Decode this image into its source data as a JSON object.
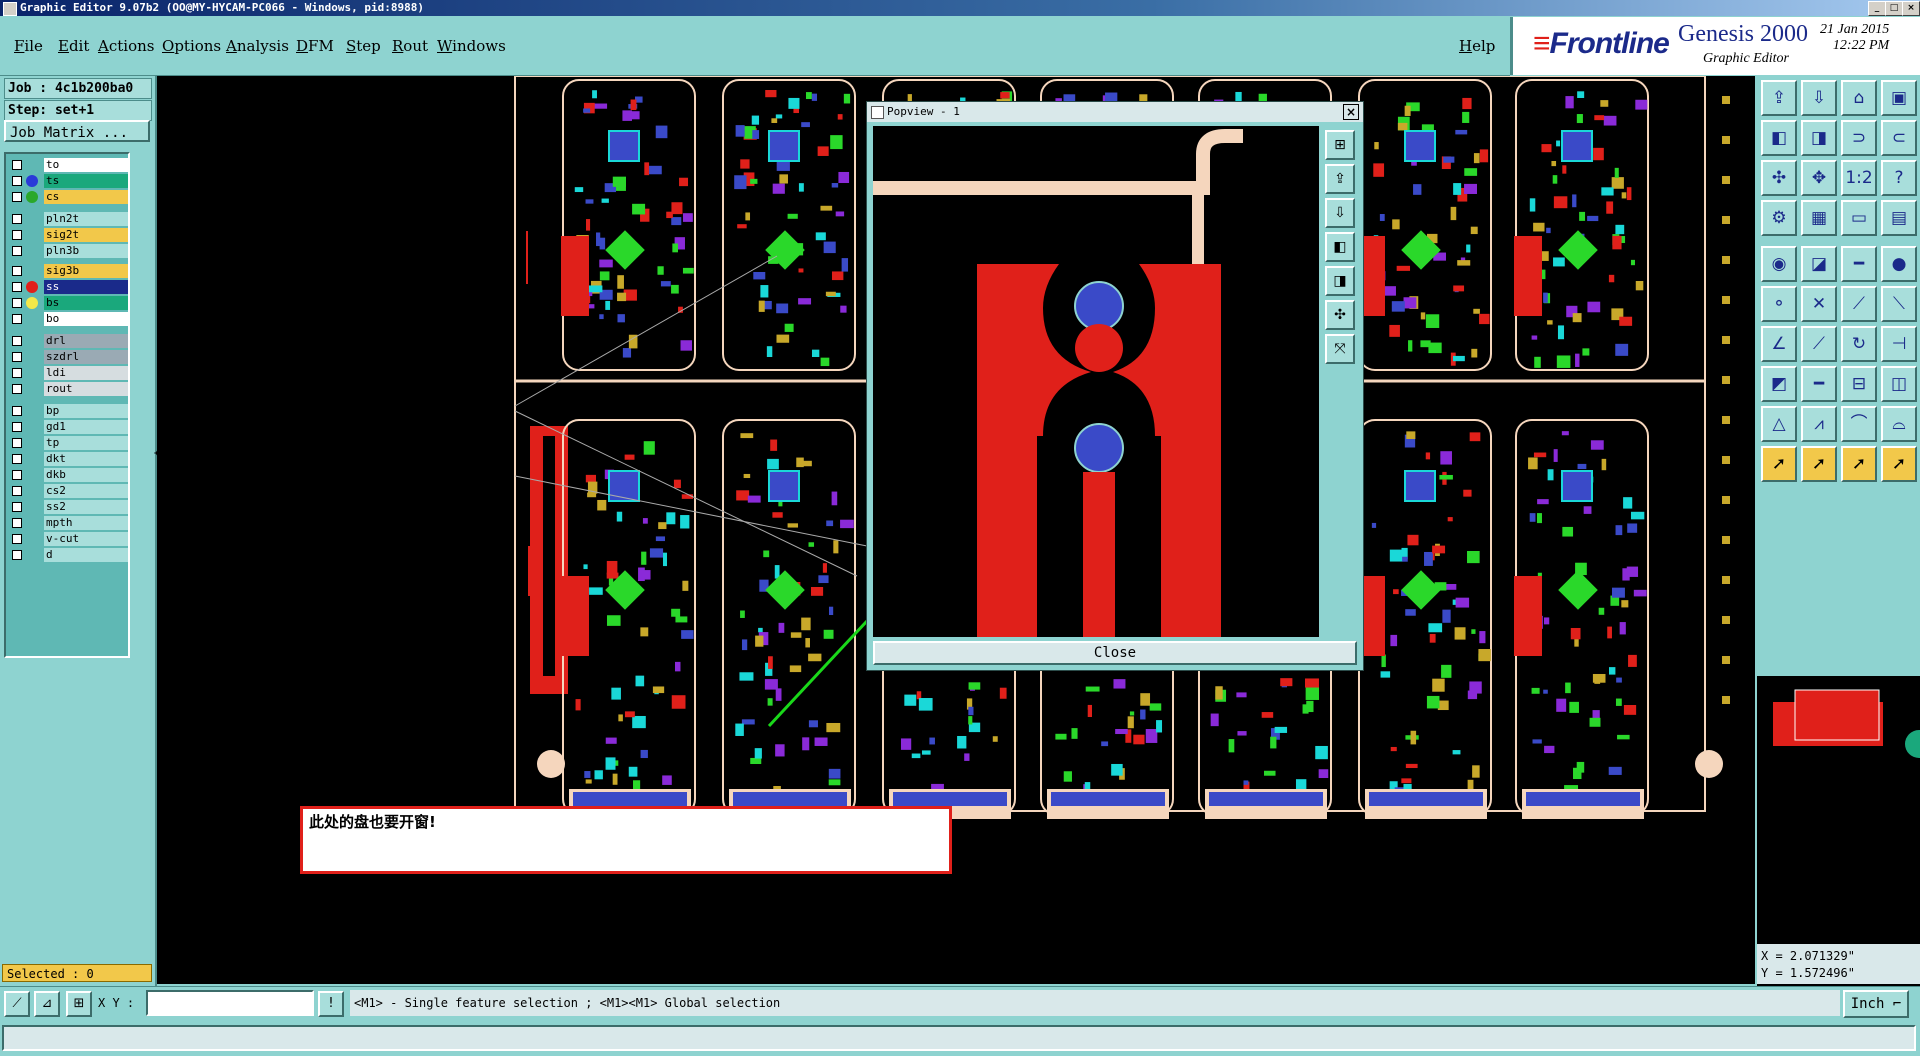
{
  "window": {
    "title": "Graphic Editor 9.07b2 (OO@MY-HYCAM-PC066 - Windows, pid:8988)",
    "controls": [
      "_",
      "□",
      "×"
    ]
  },
  "menu": [
    "File",
    "Edit",
    "Actions",
    "Options",
    "Analysis",
    "DFM",
    "Step",
    "Rout",
    "Windows"
  ],
  "help_label": "Help",
  "brand": {
    "logo": "Frontline",
    "product": "Genesis 2000",
    "subtitle": "Graphic Editor",
    "date": "21 Jan 2015",
    "time": "12:22 PM"
  },
  "job": {
    "job_line": "Job : 4c1b200ba0",
    "step_line": "Step: set+1",
    "matrix_button": "Job Matrix ..."
  },
  "layers": [
    {
      "name": "to",
      "color": "#ffffff",
      "dot": ""
    },
    {
      "name": "ts",
      "color": "#1aa87c",
      "dot": "#2a3ad8"
    },
    {
      "name": "cs",
      "color": "#f2c84a",
      "dot": "#2aa82a"
    },
    {
      "name": "pln2t",
      "color": "#a8dedb",
      "dot": ""
    },
    {
      "name": "sig2t",
      "color": "#f2c84a",
      "dot": ""
    },
    {
      "name": "pln3b",
      "color": "#a8dedb",
      "dot": ""
    },
    {
      "name": "sig3b",
      "color": "#f2c84a",
      "dot": ""
    },
    {
      "name": "ss",
      "color": "#1a2a8a",
      "dot": "#e0201a"
    },
    {
      "name": "bs",
      "color": "#1aa87c",
      "dot": "#f2e84a"
    },
    {
      "name": "bo",
      "color": "#ffffff",
      "dot": ""
    },
    {
      "name": "drl",
      "color": "#9aaab4",
      "dot": ""
    },
    {
      "name": "szdrl",
      "color": "#9aaab4",
      "dot": ""
    },
    {
      "name": "ldi",
      "color": "#d6dde0",
      "dot": ""
    },
    {
      "name": "rout",
      "color": "#d6dde0",
      "dot": ""
    },
    {
      "name": "bp",
      "color": "#a8dedb",
      "dot": ""
    },
    {
      "name": "gd1",
      "color": "#a8dedb",
      "dot": ""
    },
    {
      "name": "tp",
      "color": "#a8dedb",
      "dot": ""
    },
    {
      "name": "dkt",
      "color": "#a8dedb",
      "dot": ""
    },
    {
      "name": "dkb",
      "color": "#a8dedb",
      "dot": ""
    },
    {
      "name": "cs2",
      "color": "#a8dedb",
      "dot": ""
    },
    {
      "name": "ss2",
      "color": "#a8dedb",
      "dot": ""
    },
    {
      "name": "mpth",
      "color": "#a8dedb",
      "dot": ""
    },
    {
      "name": "v-cut",
      "color": "#a8dedb",
      "dot": ""
    },
    {
      "name": "d",
      "color": "#a8dedb",
      "dot": ""
    }
  ],
  "selected_label": "Selected : 0",
  "popview": {
    "title": "Popview - 1",
    "close_button": "Close"
  },
  "annotation": "此处的盘也要开窗!",
  "coords": {
    "x_line": "X = 2.071329\"",
    "y_line": "Y = 1.572496\""
  },
  "bottom": {
    "xy_label": "X Y :",
    "xy_value": "",
    "hint": "<M1> - Single feature selection ; <M1><M1> Global selection",
    "unit": "Inch"
  },
  "colors": {
    "panel": "#8ed3d0",
    "canvas_bg": "#000000",
    "copper": "#e0201a",
    "pad": "#3a4ac8",
    "outline": "#f5d6bd",
    "arrow": "#1ad81a"
  }
}
